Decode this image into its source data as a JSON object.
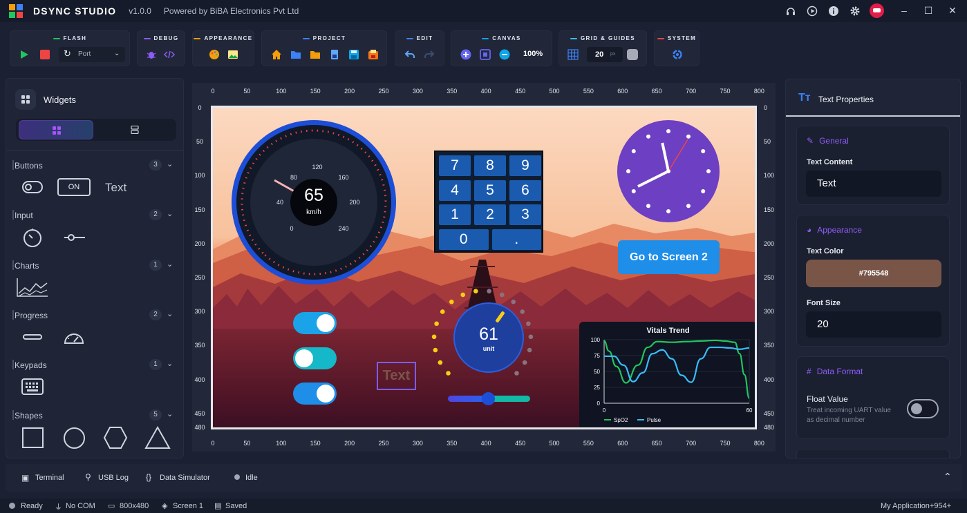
{
  "app": {
    "name": "DSYNC STUDIO",
    "version": "v1.0.0",
    "powered": "Powered by BiBA Electronics Pvt Ltd"
  },
  "window_controls": {
    "minimize": "–",
    "maximize": "☐",
    "close": "✕"
  },
  "toolbar": {
    "flash": "FLASH",
    "port": "Port",
    "debug": "DEBUG",
    "appearance": "APPEARANCE",
    "project": "PROJECT",
    "edit": "EDIT",
    "canvas": "CANVAS",
    "zoom": "100%",
    "grid": "GRID & GUIDES",
    "grid_size": "20",
    "grid_unit": "px",
    "system": "SYSTEM"
  },
  "colors": {
    "accent": "#8b5cf6",
    "text_color": "#795548",
    "gauge_ring": "#2563eb",
    "clock": "#6d3fc3",
    "button_blue": "#1e8ee8",
    "toggle": "#1aa3e8"
  },
  "widgets": {
    "title": "Widgets",
    "categories": [
      {
        "name": "Buttons",
        "count": "3"
      },
      {
        "name": "Input",
        "count": "2"
      },
      {
        "name": "Charts",
        "count": "1"
      },
      {
        "name": "Progress",
        "count": "2"
      },
      {
        "name": "Keypads",
        "count": "1"
      },
      {
        "name": "Shapes",
        "count": "5"
      }
    ],
    "button_on": "ON",
    "button_text": "Text"
  },
  "ruler": {
    "x": [
      "0",
      "50",
      "100",
      "150",
      "200",
      "250",
      "300",
      "350",
      "400",
      "450",
      "500",
      "550",
      "600",
      "650",
      "700",
      "750",
      "800"
    ],
    "y": [
      "0",
      "50",
      "100",
      "150",
      "200",
      "250",
      "300",
      "350",
      "400",
      "450",
      "480"
    ]
  },
  "canvas": {
    "speed": "65",
    "speed_unit": "km/h",
    "speed_ticks": [
      "0",
      "40",
      "80",
      "120",
      "160",
      "200",
      "240"
    ],
    "keypad": [
      "7",
      "8",
      "9",
      "4",
      "5",
      "6",
      "1",
      "2",
      "3",
      "0",
      "."
    ],
    "screen_button": "Go to Screen 2",
    "dial_value": "61",
    "dial_unit": "unit",
    "text_widget": "Text",
    "chart_title": "Vitals Trend"
  },
  "chart_data": {
    "type": "line",
    "title": "Vitals Trend",
    "xlim": [
      0,
      60
    ],
    "ylim": [
      0,
      100
    ],
    "x_ticks": [
      "0",
      "60"
    ],
    "y_ticks": [
      "100",
      "75",
      "50",
      "25",
      "0"
    ],
    "series": [
      {
        "name": "SpO2",
        "color": "#22c55e",
        "x": [
          0,
          2,
          5,
          9,
          14,
          18,
          22,
          28,
          34,
          40,
          46,
          50,
          54,
          56,
          58,
          60
        ],
        "y": [
          98,
          82,
          58,
          32,
          60,
          88,
          97,
          96,
          97,
          98,
          99,
          98,
          96,
          78,
          45,
          8
        ]
      },
      {
        "name": "Pulse",
        "color": "#38bdf8",
        "x": [
          0,
          4,
          8,
          12,
          16,
          20,
          24,
          28,
          32,
          36,
          40,
          44,
          48,
          52,
          56,
          60
        ],
        "y": [
          74,
          74,
          60,
          34,
          48,
          78,
          84,
          70,
          44,
          33,
          70,
          88,
          88,
          87,
          85,
          87
        ]
      }
    ]
  },
  "properties": {
    "title": "Text Properties",
    "general": "General",
    "text_content_label": "Text Content",
    "text_content": "Text",
    "appearance": "Appearance",
    "text_color_label": "Text Color",
    "text_color": "#795548",
    "font_size_label": "Font Size",
    "font_size": "20",
    "data_format": "Data Format",
    "float_label": "Float Value",
    "float_desc": "Treat incoming UART value as decimal number"
  },
  "bottom": {
    "terminal": "Terminal",
    "usb": "USB Log",
    "sim": "Data Simulator",
    "idle": "Idle"
  },
  "status": {
    "ready": "Ready",
    "com": "No COM",
    "res": "800x480",
    "screen": "Screen 1",
    "saved": "Saved",
    "app": "My Application+954+"
  }
}
